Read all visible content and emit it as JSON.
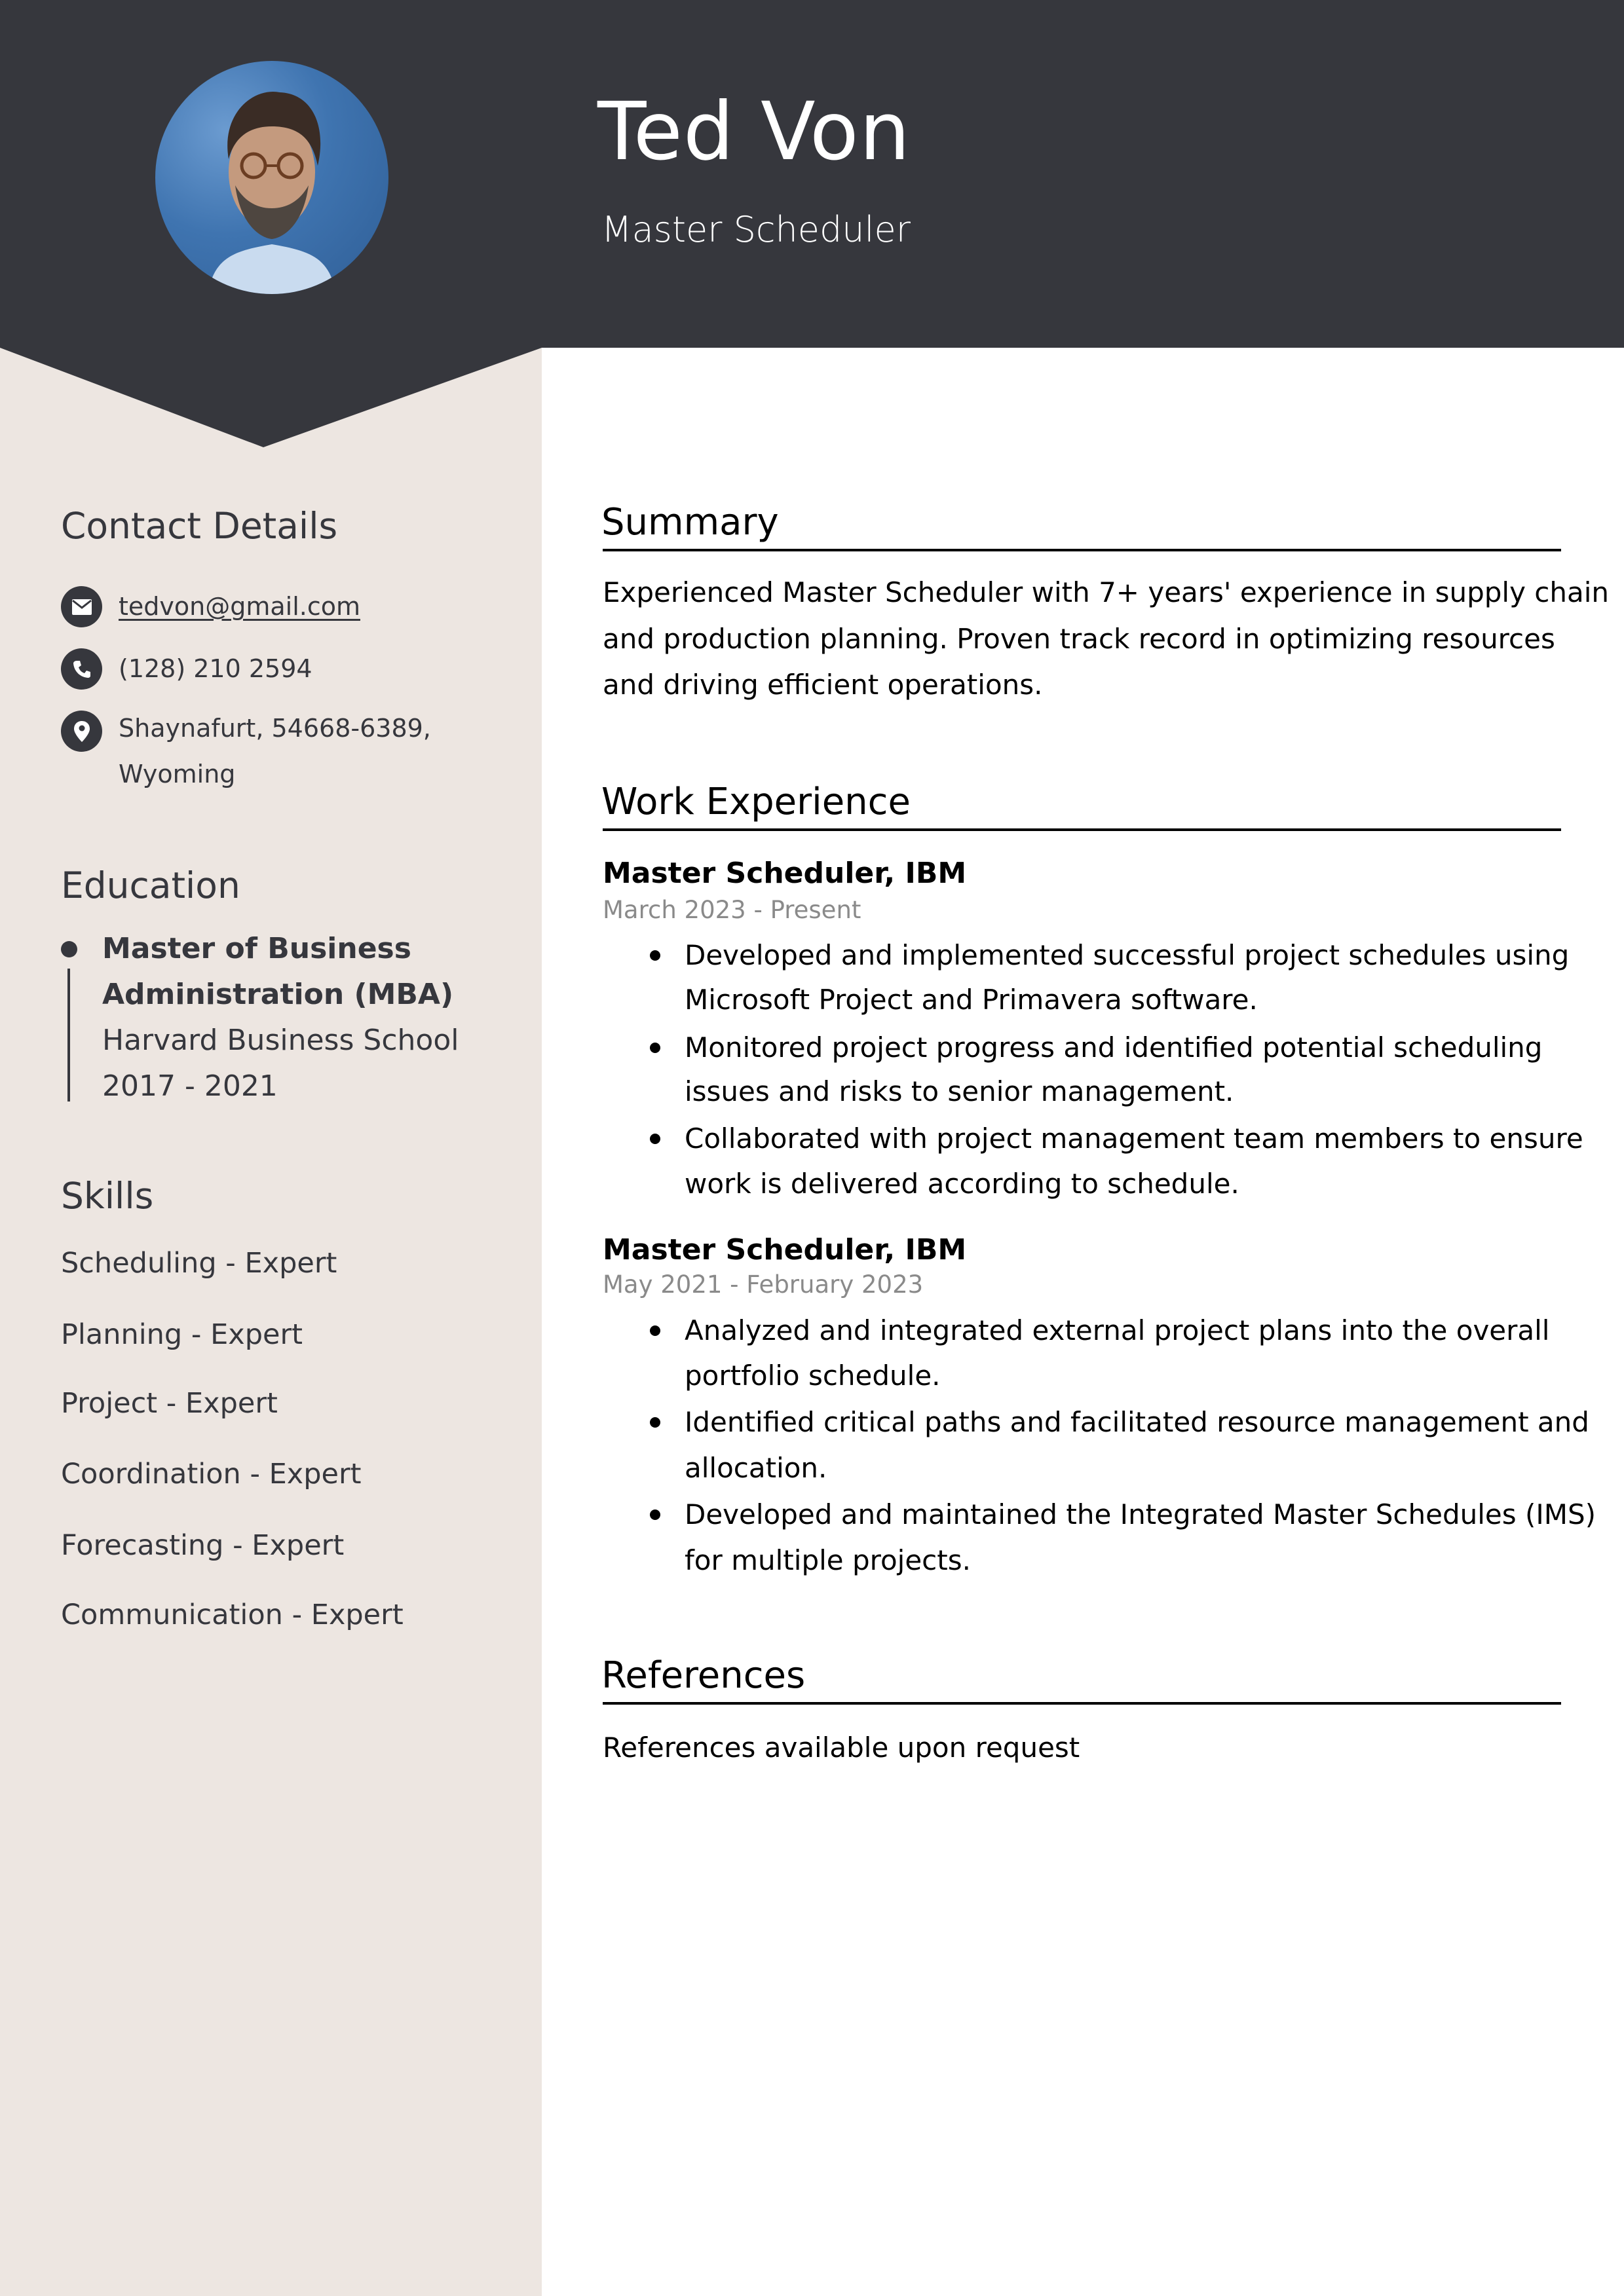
{
  "colors": {
    "header_bg": "#36373d",
    "sidebar_bg": "#ede6e1",
    "main_bg": "#ffffff",
    "sidebar_text": "#36373d",
    "date_text": "#8a8a8a"
  },
  "header": {
    "name": "Ted Von",
    "role": "Master Scheduler",
    "photo_alt": "profile-photo"
  },
  "sidebar": {
    "contact": {
      "title": "Contact Details",
      "email": {
        "icon": "envelope-icon",
        "value": "tedvon@gmail.com"
      },
      "phone": {
        "icon": "phone-icon",
        "value": "(128) 210 2594"
      },
      "address": {
        "icon": "map-pin-icon",
        "line1": "Shaynafurt, 54668-6389,",
        "line2": "Wyoming"
      }
    },
    "education": {
      "title": "Education",
      "items": [
        {
          "degree_line1": "Master of Business",
          "degree_line2": "Administration (MBA)",
          "school": "Harvard Business School",
          "years": "2017 - 2021"
        }
      ]
    },
    "skills": {
      "title": "Skills",
      "items": [
        "Scheduling - Expert",
        "Planning - Expert",
        "Project - Expert",
        "Coordination - Expert",
        "Forecasting - Expert",
        "Communication - Expert"
      ]
    }
  },
  "main": {
    "summary": {
      "title": "Summary",
      "lines": [
        "Experienced Master Scheduler with 7+ years' experience in supply chain",
        "and production planning. Proven track record in optimizing resources",
        "and driving efficient operations."
      ]
    },
    "work": {
      "title": "Work Experience",
      "jobs": [
        {
          "title": "Master Scheduler, IBM",
          "dates": "March 2023 - Present",
          "bullets": [
            [
              "Developed and implemented successful project schedules using",
              "Microsoft Project and Primavera software."
            ],
            [
              "Monitored project progress and identified potential scheduling",
              "issues and risks to senior management."
            ],
            [
              "Collaborated with project management team members to ensure",
              "work is delivered according to schedule."
            ]
          ]
        },
        {
          "title": "Master Scheduler, IBM",
          "dates": "May 2021 - February 2023",
          "bullets": [
            [
              "Analyzed and integrated external project plans into the overall",
              "portfolio schedule."
            ],
            [
              "Identified critical paths and facilitated resource management and",
              "allocation."
            ],
            [
              "Developed and maintained the Integrated Master Schedules (IMS)",
              "for multiple projects."
            ]
          ]
        }
      ]
    },
    "references": {
      "title": "References",
      "text": "References available upon request"
    }
  }
}
